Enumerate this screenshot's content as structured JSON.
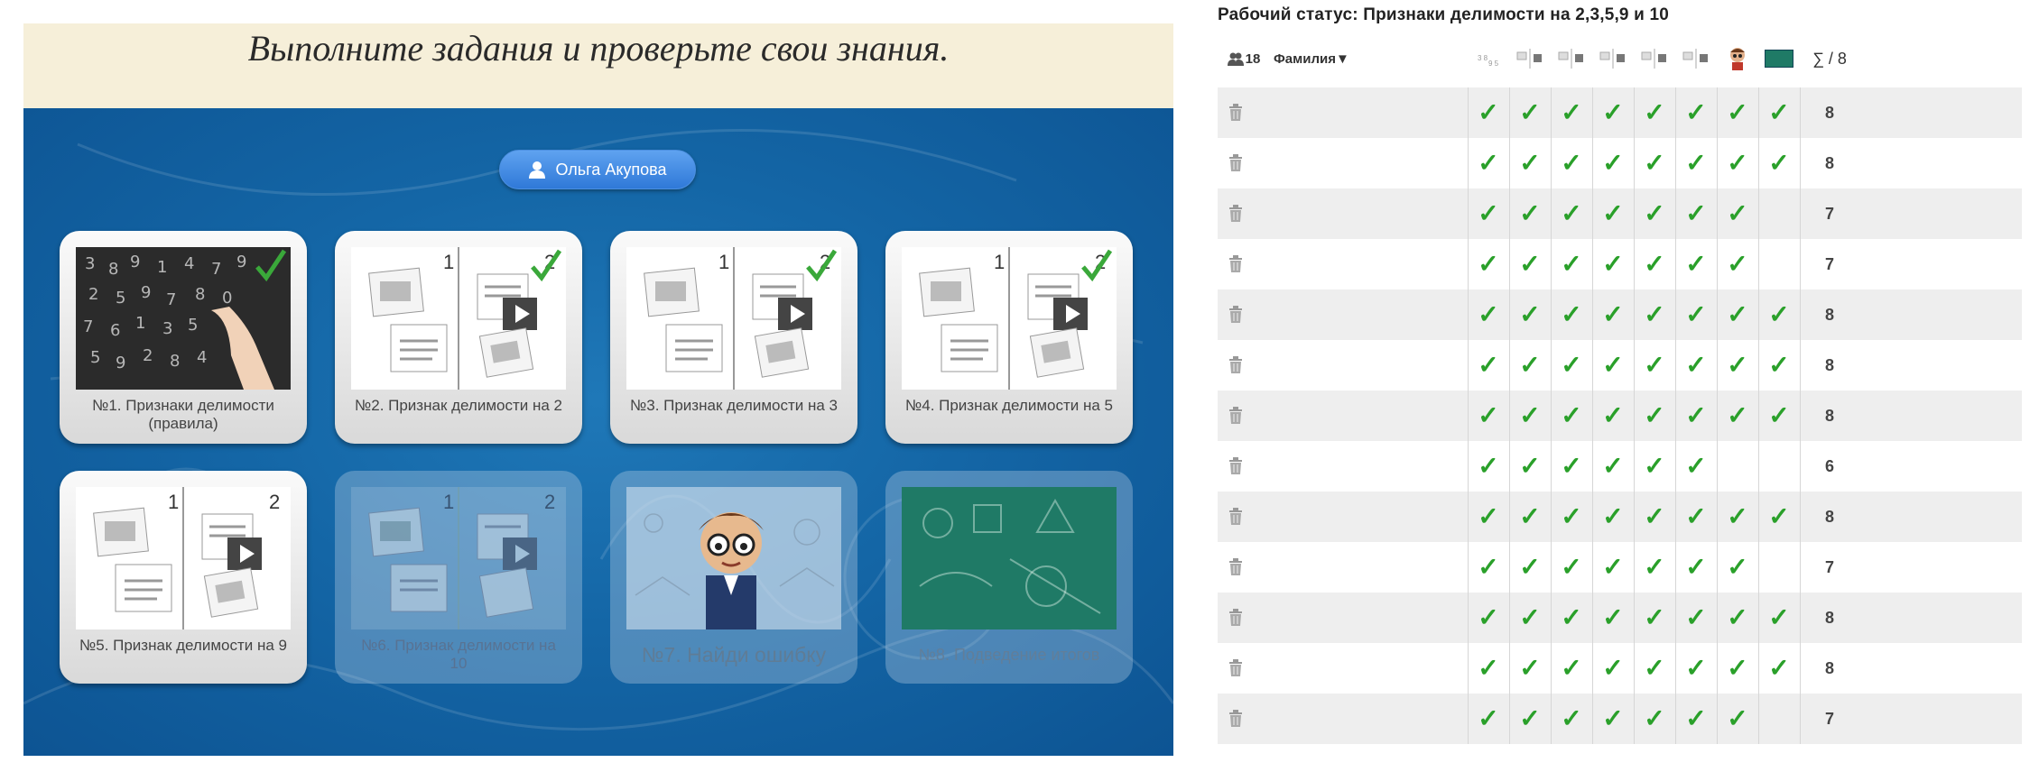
{
  "banner": {
    "title": "Выполните задания и проверьте свои знания."
  },
  "user": {
    "name": "Ольга Акупова"
  },
  "cards": [
    {
      "caption": "№1. Признаки делимости (правила)",
      "completed": true,
      "thumb": "chalkboard-photo",
      "faded": false
    },
    {
      "caption": "№2. Признак делимости на 2",
      "completed": true,
      "thumb": "book-spread",
      "faded": false
    },
    {
      "caption": "№3. Признак делимости на 3",
      "completed": true,
      "thumb": "book-spread",
      "faded": false
    },
    {
      "caption": "№4. Признак делимости на 5",
      "completed": true,
      "thumb": "book-spread",
      "faded": false
    },
    {
      "caption": "№5. Признак делимости на 9",
      "completed": false,
      "thumb": "book-spread",
      "faded": false
    },
    {
      "caption": "№6. Признак делимости на 10",
      "completed": false,
      "thumb": "book-spread",
      "faded": true
    },
    {
      "caption": "№7. Найди ошибку",
      "completed": false,
      "thumb": "scientist-boy",
      "faded": true
    },
    {
      "caption": "№8. Подведение итогов",
      "completed": false,
      "thumb": "green-chalkboard",
      "faded": true
    }
  ],
  "page_labels": {
    "one": "1",
    "two": "2"
  },
  "status": {
    "title": "Рабочий статус: Признаки делимости на 2,3,5,9 и 10",
    "students_count": "18",
    "surname_header": "Фамилия▼",
    "sum_header": "∑ / 8",
    "check_mark": "✓",
    "rows": [
      {
        "checks": [
          true,
          true,
          true,
          true,
          true,
          true,
          true,
          true
        ],
        "sum": "8"
      },
      {
        "checks": [
          true,
          true,
          true,
          true,
          true,
          true,
          true,
          true
        ],
        "sum": "8"
      },
      {
        "checks": [
          true,
          true,
          true,
          true,
          true,
          true,
          true,
          false
        ],
        "sum": "7"
      },
      {
        "checks": [
          true,
          true,
          true,
          true,
          true,
          true,
          true,
          false
        ],
        "sum": "7"
      },
      {
        "checks": [
          true,
          true,
          true,
          true,
          true,
          true,
          true,
          true
        ],
        "sum": "8"
      },
      {
        "checks": [
          true,
          true,
          true,
          true,
          true,
          true,
          true,
          true
        ],
        "sum": "8"
      },
      {
        "checks": [
          true,
          true,
          true,
          true,
          true,
          true,
          true,
          true
        ],
        "sum": "8"
      },
      {
        "checks": [
          true,
          true,
          true,
          true,
          true,
          true,
          false,
          false
        ],
        "sum": "6"
      },
      {
        "checks": [
          true,
          true,
          true,
          true,
          true,
          true,
          true,
          true
        ],
        "sum": "8"
      },
      {
        "checks": [
          true,
          true,
          true,
          true,
          true,
          true,
          true,
          false
        ],
        "sum": "7"
      },
      {
        "checks": [
          true,
          true,
          true,
          true,
          true,
          true,
          true,
          true
        ],
        "sum": "8"
      },
      {
        "checks": [
          true,
          true,
          true,
          true,
          true,
          true,
          true,
          true
        ],
        "sum": "8"
      },
      {
        "checks": [
          true,
          true,
          true,
          true,
          true,
          true,
          true,
          false
        ],
        "sum": "7"
      }
    ]
  },
  "colors": {
    "board": "#1466a6",
    "banner": "#f6efd9",
    "check": "#2aa02a",
    "user_button": "#3b86e0"
  }
}
